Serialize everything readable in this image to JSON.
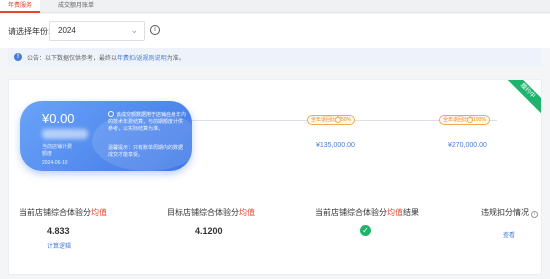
{
  "tabs": [
    {
      "label": "年费服务"
    },
    {
      "label": "成交额月账单"
    }
  ],
  "filter": {
    "label": "请选择年份:",
    "year": "2024"
  },
  "notice": {
    "prefix": "公告：以下数据仅供参考，最终以",
    "link": "年费扣/返规则说明",
    "suffix": "为准。"
  },
  "ribbon": "履约中",
  "card": {
    "amount": "¥0.00",
    "sub_line1": "当前店铺计费",
    "sub_line2": "额度",
    "date": "2024-06-10",
    "note": "该成交额数据用于店铺自身年内的技术年费结算，与前期额度计供参考，以实际结算为准。",
    "note2": "温馨提示：只有账单周期内的数据成交才能享受。"
  },
  "milestones": [
    {
      "tag": "全年退回比例50%",
      "amount": "¥135,000.00"
    },
    {
      "tag": "全年退回比例100%",
      "amount": "¥270,000.00"
    }
  ],
  "metrics": [
    {
      "label_main": "当前店铺综合体验分",
      "label_hl": "均值",
      "value": "4.833",
      "link": "计算逻辑"
    },
    {
      "label_main": "目标店铺综合体验分",
      "label_hl": "均值",
      "value": "4.1200"
    },
    {
      "label_main": "当前店铺综合体验分",
      "label_hl": "均值",
      "label_tail": "结果"
    },
    {
      "label_main": "违规扣分情况",
      "link": "查看"
    }
  ],
  "colors": {
    "accent_red": "#e5482f",
    "link_blue": "#4b7bd8",
    "success_green": "#1fb46c",
    "milestone_orange": "#f3a94d"
  }
}
